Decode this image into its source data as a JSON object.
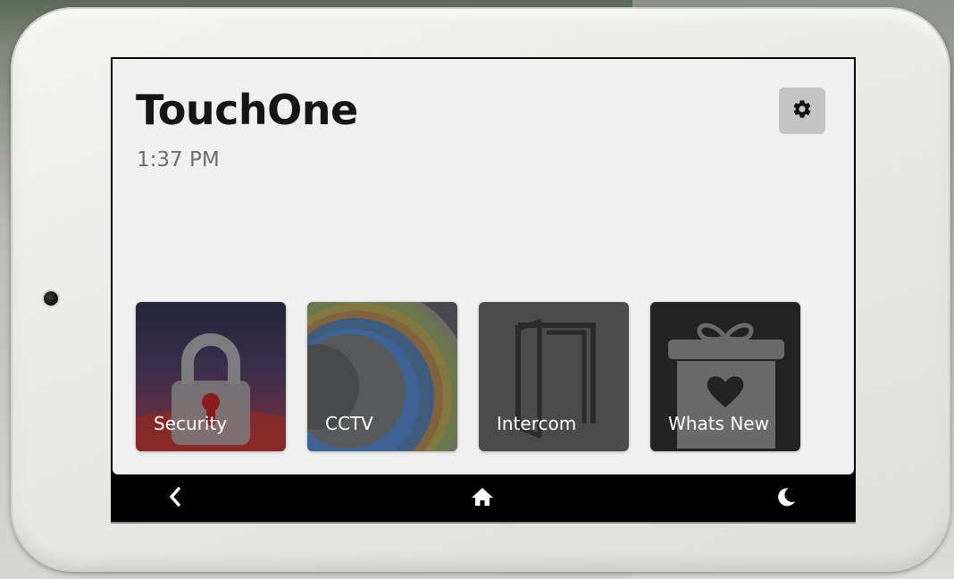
{
  "app": {
    "title": "TouchOne",
    "time": "1:37 PM"
  },
  "header": {
    "settings_icon": "gear-icon"
  },
  "tiles": [
    {
      "label": "Security",
      "icon": "padlock-icon",
      "color": "#2e2c45"
    },
    {
      "label": "CCTV",
      "icon": "camera-lens-icon",
      "color": "#4a4d55"
    },
    {
      "label": "Intercom",
      "icon": "door-icon",
      "color": "#4b4b4b"
    },
    {
      "label": "Whats New",
      "icon": "gift-heart-icon",
      "color": "#232323"
    }
  ],
  "navbar": {
    "back_icon": "chevron-left-icon",
    "home_icon": "home-icon",
    "sleep_icon": "moon-icon"
  },
  "colors": {
    "screen_bg": "#f0f0f0",
    "navbar_bg": "#000000",
    "settings_btn_bg": "#c4c4c4",
    "title_text": "#151515",
    "time_text": "#6d6d6d"
  }
}
